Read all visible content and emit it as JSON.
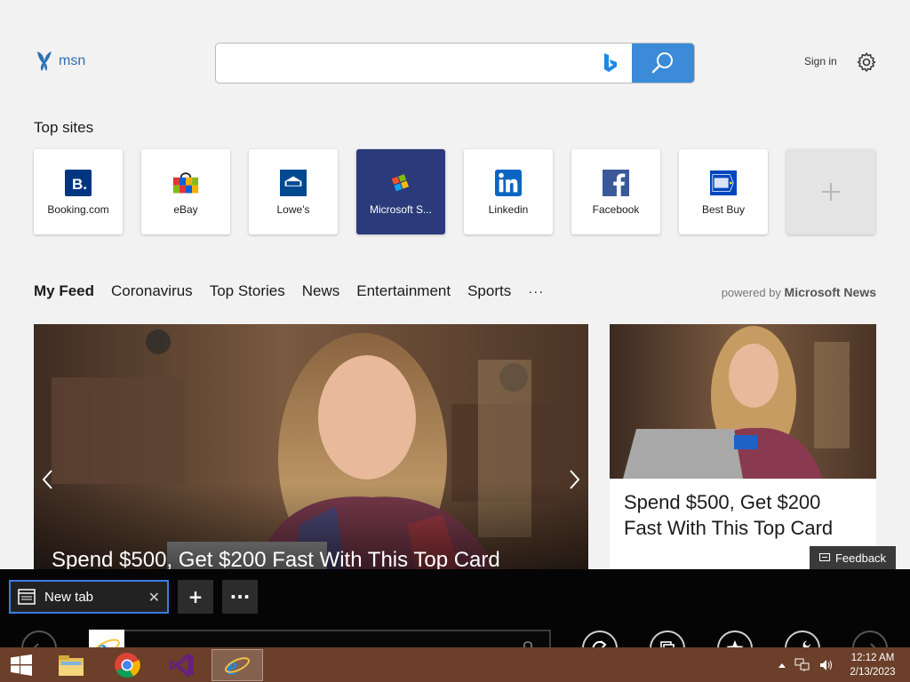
{
  "header": {
    "logo_text": "msn",
    "search_placeholder": "",
    "signin": "Sign in"
  },
  "topsites": {
    "title": "Top sites",
    "tiles": [
      {
        "label": "Booking.com",
        "icon": "booking-icon"
      },
      {
        "label": "eBay",
        "icon": "ebay-icon"
      },
      {
        "label": "Lowe's",
        "icon": "lowes-icon"
      },
      {
        "label": "Microsoft S...",
        "icon": "microsoft-store-icon"
      },
      {
        "label": "Linkedin",
        "icon": "linkedin-icon"
      },
      {
        "label": "Facebook",
        "icon": "facebook-icon"
      },
      {
        "label": "Best Buy",
        "icon": "bestbuy-icon"
      },
      {
        "label": "",
        "icon": "plus-icon"
      }
    ]
  },
  "feed": {
    "tabs": [
      "My Feed",
      "Coronavirus",
      "Top Stories",
      "News",
      "Entertainment",
      "Sports",
      "···"
    ],
    "powered_by_prefix": "powered by",
    "powered_by_brand": "Microsoft News",
    "hero_title": "Spend $500, Get $200 Fast With This Top Card",
    "card_title": "Spend $500, Get $200 Fast With This Top Card",
    "feedback": "Feedback"
  },
  "browser": {
    "tab_label": "New tab",
    "tab_close": "✕",
    "new_tab": "+",
    "more": "···"
  },
  "taskbar": {
    "time": "12:12 AM",
    "date": "2/13/2023"
  },
  "colors": {
    "accent": "#3b8bd8",
    "store_tile": "#2b3a7a",
    "taskbar": "#6b3f2a"
  }
}
